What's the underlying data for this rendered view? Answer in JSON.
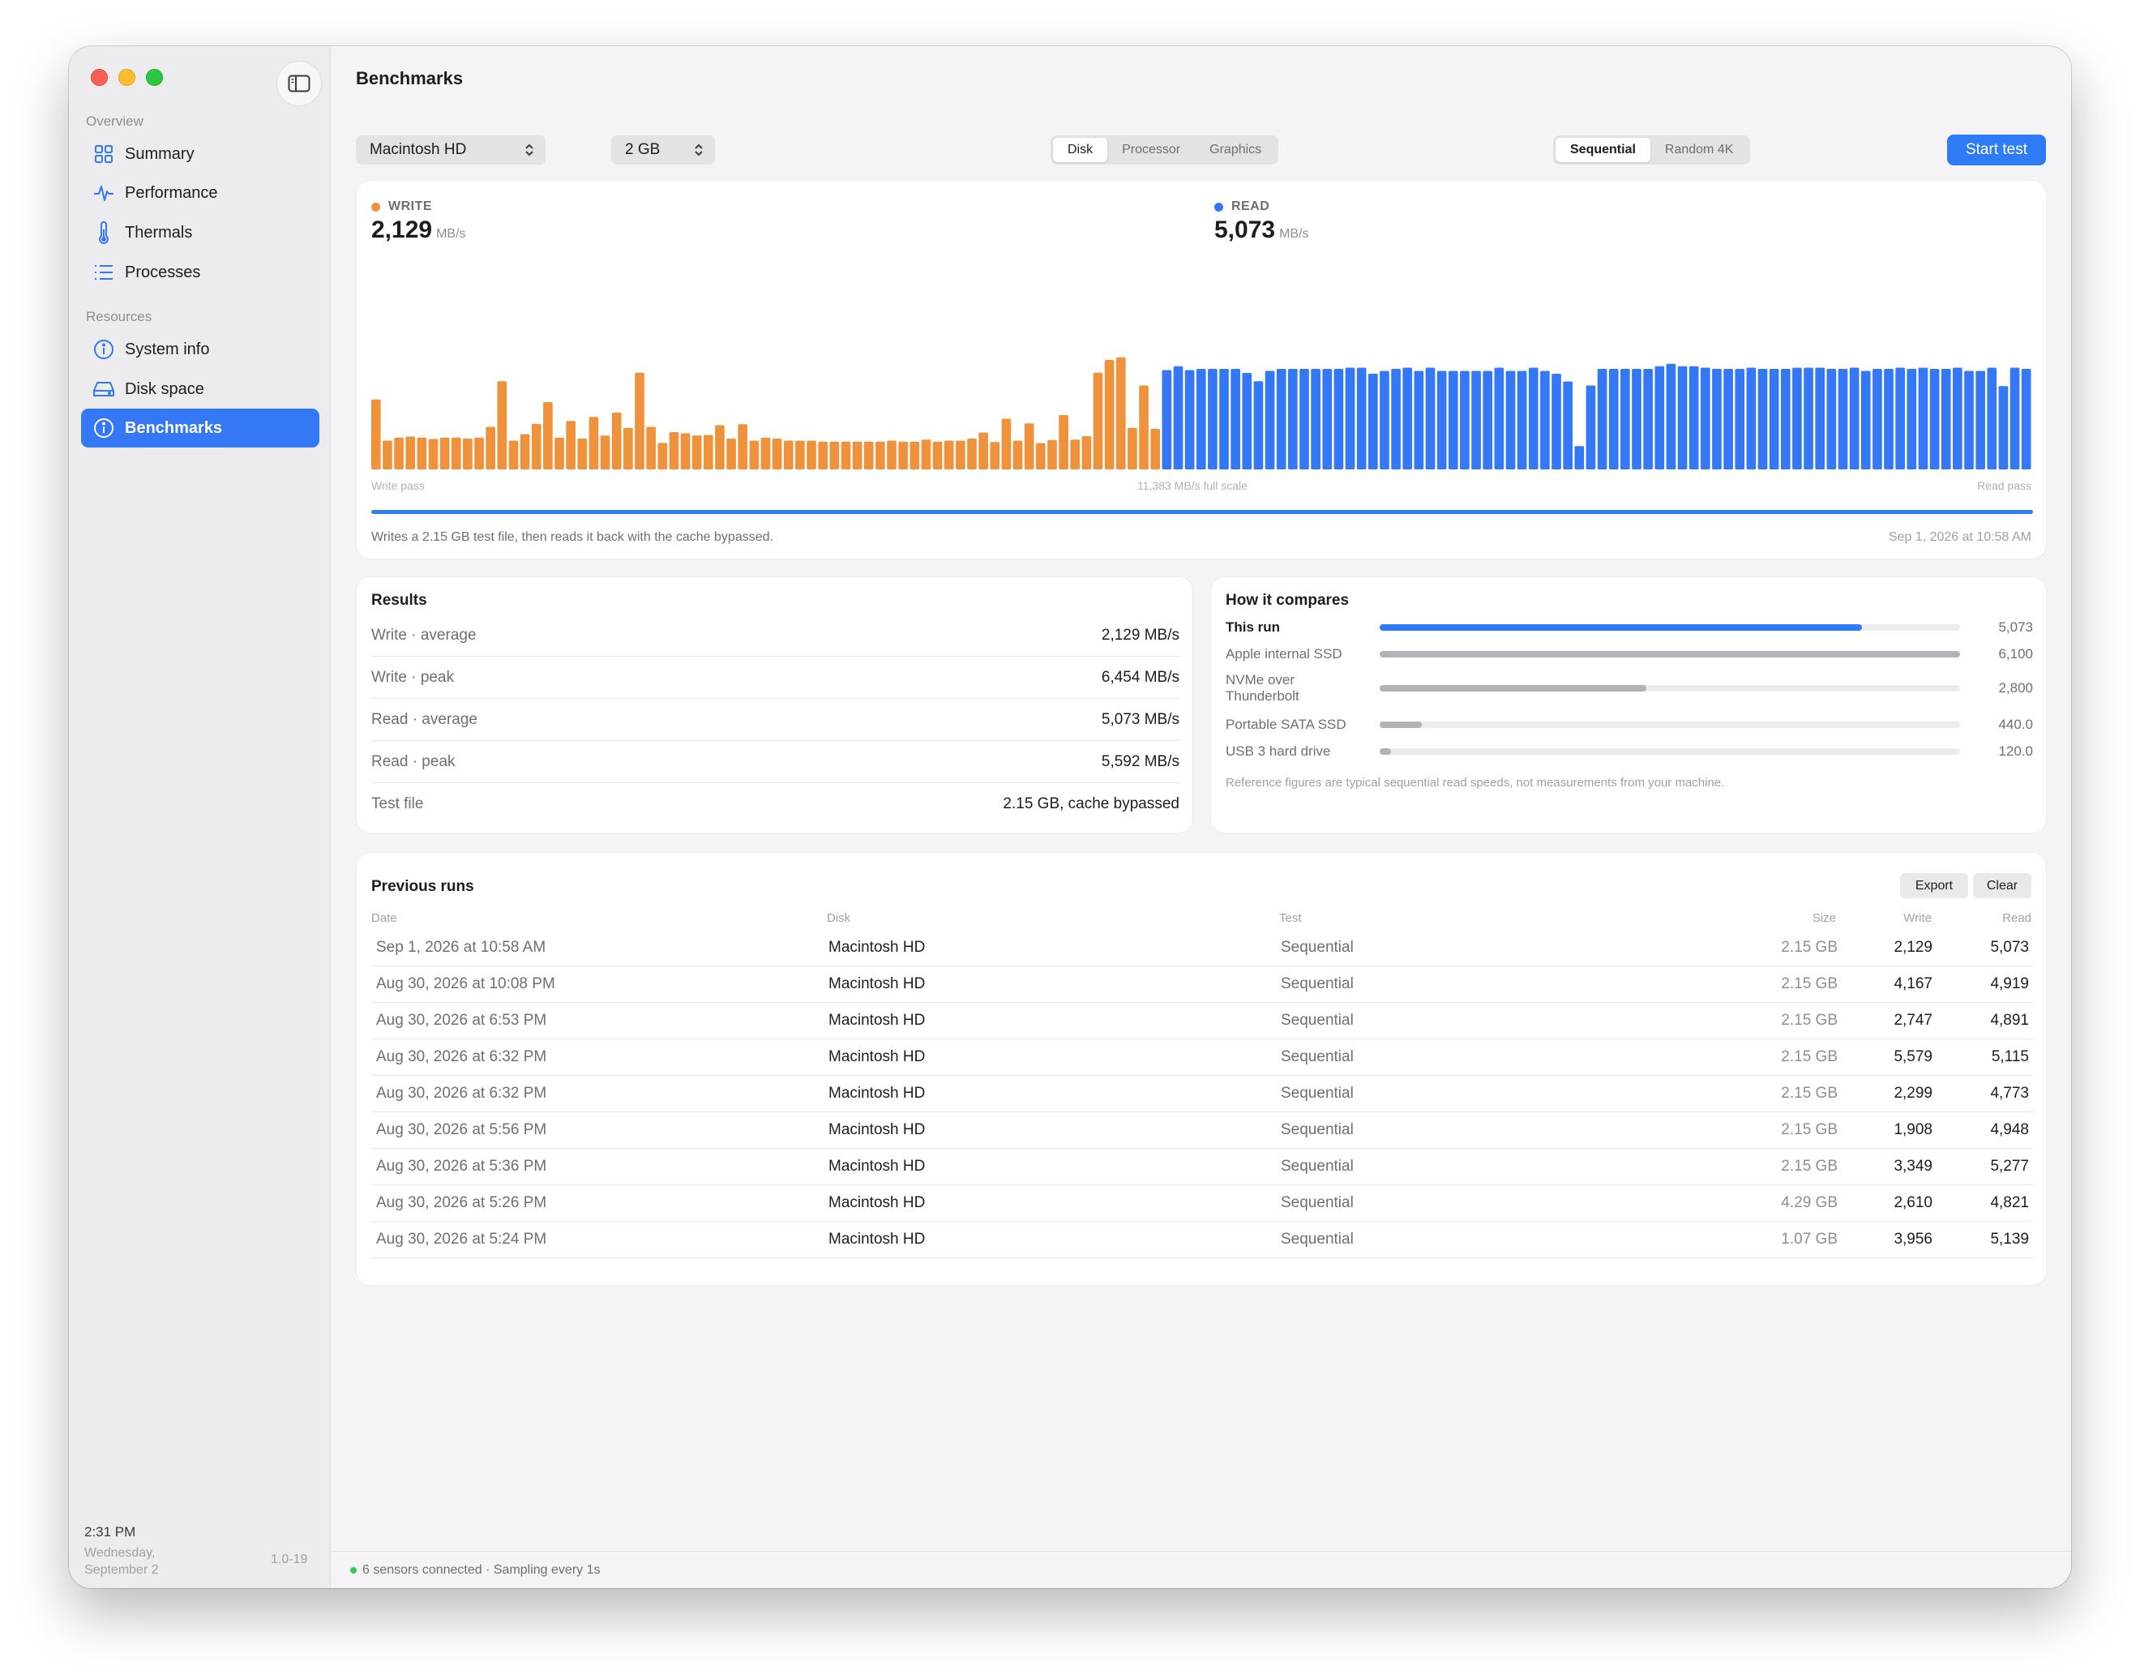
{
  "sidebar": {
    "section_overview": "Overview",
    "section_resources": "Resources",
    "items": [
      {
        "label": "Summary",
        "icon": "grid-icon"
      },
      {
        "label": "Performance",
        "icon": "pulse-icon"
      },
      {
        "label": "Thermals",
        "icon": "thermometer-icon"
      },
      {
        "label": "Processes",
        "icon": "list-icon"
      },
      {
        "label": "System info",
        "icon": "info-icon"
      },
      {
        "label": "Disk space",
        "icon": "disk-icon"
      },
      {
        "label": "Benchmarks",
        "icon": "info-icon",
        "active": true
      }
    ],
    "time": "2:31 PM",
    "date": "Wednesday, September 2",
    "version": "1.0-19"
  },
  "header": {
    "title": "Benchmarks",
    "disk_select": "Macintosh HD",
    "size_select": "2 GB",
    "kind_tabs": [
      "Disk",
      "Processor",
      "Graphics"
    ],
    "kind_selected": "Disk",
    "mode_tabs": [
      "Sequential",
      "Random 4K"
    ],
    "mode_selected": "Sequential",
    "start_button": "Start test"
  },
  "chart": {
    "write_label": "WRITE",
    "write_value": "2,129",
    "read_label": "READ",
    "read_value": "5,073",
    "unit": "MB/s",
    "write_color": "#f0923b",
    "read_color": "#3478f6",
    "caption_left": "Write pass",
    "caption_center": "11,383 MB/s full scale",
    "caption_right": "Read pass",
    "progress": 1.0,
    "note": "Writes a 2.15 GB test file, then reads it back with the cache bypassed.",
    "timestamp": "Sep 1, 2026 at 10:58 AM"
  },
  "chart_data": {
    "type": "bar",
    "ylim": [
      0,
      11383
    ],
    "series": [
      {
        "name": "WRITE",
        "values": [
          3450,
          1420,
          1570,
          1620,
          1570,
          1500,
          1570,
          1570,
          1520,
          1570,
          2100,
          4350,
          1420,
          1740,
          2250,
          3320,
          1570,
          2390,
          1520,
          2590,
          1670,
          2800,
          2050,
          4770,
          2100,
          1310,
          1840,
          1780,
          1670,
          1700,
          2180,
          1520,
          2230,
          1420,
          1570,
          1520,
          1420,
          1420,
          1420,
          1370,
          1370,
          1370,
          1370,
          1370,
          1370,
          1420,
          1370,
          1370,
          1470,
          1370,
          1420,
          1420,
          1520,
          1820,
          1350,
          2500,
          1420,
          2270,
          1300,
          1450,
          2680,
          1470,
          1640,
          4770,
          5400,
          5530,
          2050,
          4140,
          2000
        ],
        "color": "#f0923b"
      },
      {
        "name": "READ",
        "values": [
          4900,
          5090,
          4900,
          4960,
          4960,
          4960,
          4960,
          4760,
          4350,
          4860,
          4960,
          4960,
          4960,
          4960,
          4960,
          4960,
          5020,
          5020,
          4720,
          4860,
          4960,
          5020,
          4860,
          5020,
          4860,
          4860,
          4860,
          4860,
          4860,
          5020,
          4860,
          4860,
          5020,
          4860,
          4720,
          4340,
          1150,
          4140,
          4960,
          4960,
          4960,
          4960,
          4960,
          5090,
          5210,
          5090,
          5090,
          5020,
          4960,
          4960,
          4960,
          5020,
          4960,
          4960,
          4960,
          5020,
          5020,
          5020,
          4960,
          4960,
          5020,
          4860,
          4960,
          4960,
          5020,
          4960,
          5020,
          4960,
          4960,
          5020,
          4860,
          4860,
          5020,
          4110,
          5020,
          4960
        ],
        "color": "#3478f6"
      }
    ]
  },
  "results": {
    "title": "Results",
    "rows": [
      {
        "label": "Write · average",
        "value": "2,129 MB/s"
      },
      {
        "label": "Write · peak",
        "value": "6,454 MB/s"
      },
      {
        "label": "Read · average",
        "value": "5,073 MB/s"
      },
      {
        "label": "Read · peak",
        "value": "5,592 MB/s"
      },
      {
        "label": "Test file",
        "value": "2.15 GB, cache bypassed"
      }
    ]
  },
  "compare": {
    "title": "How it compares",
    "scale_max": 6100,
    "rows": [
      {
        "name": "This run",
        "value": 5073,
        "display": "5,073",
        "current": true
      },
      {
        "name": "Apple internal SSD",
        "value": 6100,
        "display": "6,100"
      },
      {
        "name": "NVMe over Thunderbolt",
        "value": 2800,
        "display": "2,800"
      },
      {
        "name": "Portable SATA SSD",
        "value": 440,
        "display": "440.0"
      },
      {
        "name": "USB 3 hard drive",
        "value": 120,
        "display": "120.0"
      }
    ],
    "note": "Reference figures are typical sequential read speeds, not measurements from your machine."
  },
  "runs": {
    "title": "Previous runs",
    "export_button": "Export",
    "clear_button": "Clear",
    "columns": [
      "Date",
      "Disk",
      "Test",
      "Size",
      "Write",
      "Read"
    ],
    "rows": [
      {
        "date": "Sep 1, 2026 at 10:58 AM",
        "disk": "Macintosh HD",
        "test": "Sequential",
        "size": "2.15 GB",
        "write": "2,129",
        "read": "5,073"
      },
      {
        "date": "Aug 30, 2026 at 10:08 PM",
        "disk": "Macintosh HD",
        "test": "Sequential",
        "size": "2.15 GB",
        "write": "4,167",
        "read": "4,919"
      },
      {
        "date": "Aug 30, 2026 at 6:53 PM",
        "disk": "Macintosh HD",
        "test": "Sequential",
        "size": "2.15 GB",
        "write": "2,747",
        "read": "4,891"
      },
      {
        "date": "Aug 30, 2026 at 6:32 PM",
        "disk": "Macintosh HD",
        "test": "Sequential",
        "size": "2.15 GB",
        "write": "5,579",
        "read": "5,115"
      },
      {
        "date": "Aug 30, 2026 at 6:32 PM",
        "disk": "Macintosh HD",
        "test": "Sequential",
        "size": "2.15 GB",
        "write": "2,299",
        "read": "4,773"
      },
      {
        "date": "Aug 30, 2026 at 5:56 PM",
        "disk": "Macintosh HD",
        "test": "Sequential",
        "size": "2.15 GB",
        "write": "1,908",
        "read": "4,948"
      },
      {
        "date": "Aug 30, 2026 at 5:36 PM",
        "disk": "Macintosh HD",
        "test": "Sequential",
        "size": "2.15 GB",
        "write": "3,349",
        "read": "5,277"
      },
      {
        "date": "Aug 30, 2026 at 5:26 PM",
        "disk": "Macintosh HD",
        "test": "Sequential",
        "size": "4.29 GB",
        "write": "2,610",
        "read": "4,821"
      },
      {
        "date": "Aug 30, 2026 at 5:24 PM",
        "disk": "Macintosh HD",
        "test": "Sequential",
        "size": "1.07 GB",
        "write": "3,956",
        "read": "5,139"
      }
    ]
  },
  "status": {
    "text": "6 sensors connected · Sampling every 1s",
    "dot_color": "#34c759"
  }
}
